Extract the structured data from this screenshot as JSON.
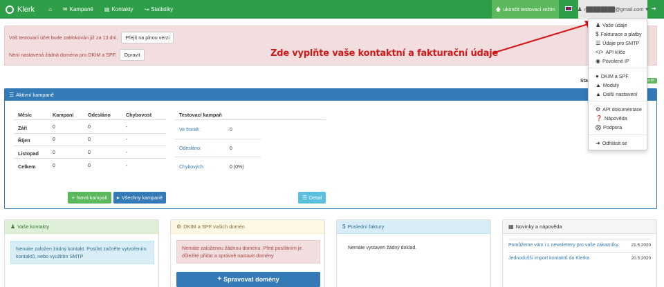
{
  "app": {
    "brand": "Klerk"
  },
  "nav": {
    "home_icon": "home-icon",
    "items": [
      {
        "label": "Kampaně",
        "icon": "envelope-icon"
      },
      {
        "label": "Kontakty",
        "icon": "contact-card-icon"
      },
      {
        "label": "Statistiky",
        "icon": "line-chart-icon"
      }
    ],
    "end_test_mode": "ukončit testovací režim",
    "user_email": "r████████@gmail.com",
    "colors": {
      "navbar": "#2e9e48",
      "end_test": "#5cb85c",
      "user_menu": "#e7e7e7"
    }
  },
  "alerts": {
    "trial_text": "Váš testovací účet bude zablokován již za 13 dní.",
    "trial_button": "Přejít na plnou verzi",
    "domain_text": "Není nastavená žádná doména pro DKIM a SPF.",
    "domain_button": "Opravit"
  },
  "callout": {
    "text": "Zde vyplňte vaše kontaktní a fakturační údaje",
    "color": "#d41818"
  },
  "dropdown": {
    "group1": [
      {
        "label": "Vaše údaje",
        "icon": "user-icon"
      },
      {
        "label": "Fakturace a platby",
        "icon": "dollar-icon"
      },
      {
        "label": "Údaje pro SMTP",
        "icon": "list-icon"
      },
      {
        "label": "API klíče",
        "icon": "code-icon"
      },
      {
        "label": "Povolené IP",
        "icon": "globe-icon"
      }
    ],
    "group2": [
      {
        "label": "DKIM a SPF",
        "icon": "circle-icon"
      },
      {
        "label": "Moduly",
        "icon": "flask-icon"
      },
      {
        "label": "Další nastavení",
        "icon": "flask-icon"
      }
    ],
    "group3": [
      {
        "label": "API dokumentace",
        "icon": "gear-icon"
      },
      {
        "label": "Nápověda",
        "icon": "question-icon"
      },
      {
        "label": "Podpora",
        "icon": "lifebuoy-icon"
      }
    ],
    "group4": [
      {
        "label": "Odhlásit se",
        "icon": "sign-out-icon"
      }
    ]
  },
  "stats": {
    "label": "Sta",
    "badge": "rozšíř"
  },
  "active_campaigns": {
    "title": "Aktivní kampaně",
    "columns": [
      "Měsíc",
      "Kampaní",
      "Odesláno",
      "Chybovost"
    ],
    "rows": [
      {
        "month": "Září",
        "campaigns": "0",
        "sent": "0",
        "errors": "-"
      },
      {
        "month": "Říjen",
        "campaigns": "0",
        "sent": "0",
        "errors": "-"
      },
      {
        "month": "Listopad",
        "campaigns": "0",
        "sent": "0",
        "errors": "-"
      },
      {
        "month": "Celkem",
        "campaigns": "0",
        "sent": "0",
        "errors": "-"
      }
    ],
    "test_header": "Testovací kampaň",
    "test_rows": [
      {
        "label": "Ve frontě:",
        "value": "0"
      },
      {
        "label": "Odesláno:",
        "value": "0"
      },
      {
        "label": "Chybových:",
        "value": "0 (0%)"
      }
    ],
    "new_campaign_button": "Nová kampaň",
    "all_campaigns_button": "Všechny kampaně",
    "detail_button": "Detail"
  },
  "contacts_panel": {
    "title": "Vaše kontakty",
    "text": "Nemáte založen žádný kontakt. Posílat začněte vytvořením kontaktů, nebo využitím SMTP",
    "head_color": "#dff0d8"
  },
  "dkim_panel": {
    "title": "DKIM a SPF vašich domén",
    "text": "Nemáte založenou žádnou doménu. Před posíláním je důležité přidat a správně nastavit domény",
    "button": "Spravovat domény",
    "head_color": "#fcf8e3"
  },
  "invoices_panel": {
    "title": "Poslední faktury",
    "text": "Nemáte vystaven žádný doklad.",
    "head_color": "#d9edf7"
  },
  "news_panel": {
    "title": "Novinky a nápověda",
    "items": [
      {
        "title": "Pomůžeme vám i s newslettery pro vaše zákazníky.",
        "date": "21.5.2020"
      },
      {
        "title": "Jednodušší import kontaktů do Klerka",
        "date": "20.5.2020"
      }
    ],
    "head_color": "#f5f5f5"
  }
}
